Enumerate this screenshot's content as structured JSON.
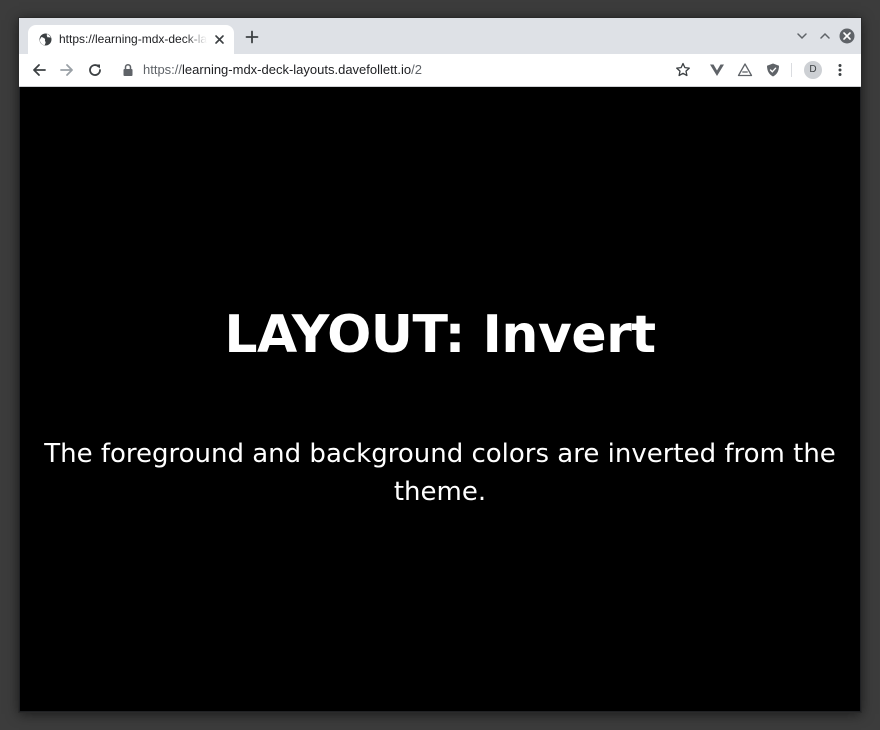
{
  "browser": {
    "tab": {
      "title": "https://learning-mdx-deck-layouts.davefollett.io/2",
      "favicon": "globe-icon"
    },
    "address_bar": {
      "scheme": "https://",
      "host": "learning-mdx-deck-layouts.davefollett.io",
      "path": "/2"
    },
    "profile_initial": "D"
  },
  "slide": {
    "title": "LAYOUT: Invert",
    "body": "The foreground and background colors are inverted from the theme.",
    "background_color": "#000000",
    "foreground_color": "#ffffff"
  }
}
